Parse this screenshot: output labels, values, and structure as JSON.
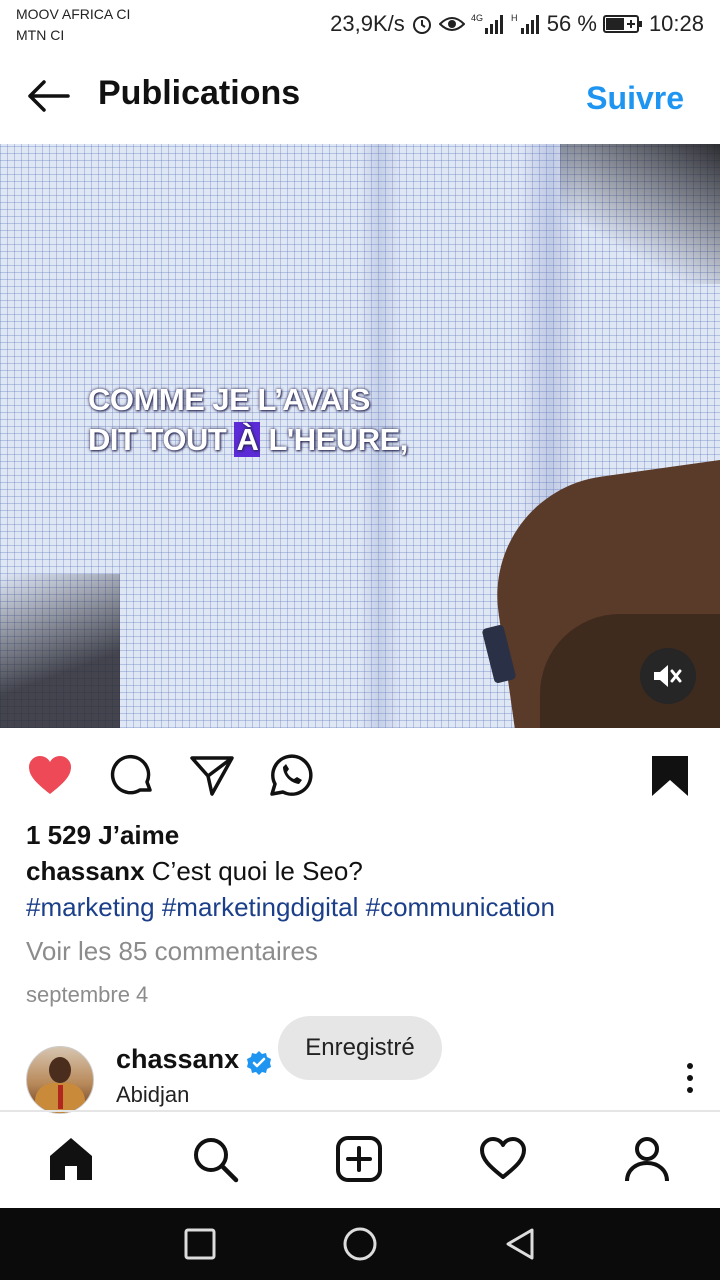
{
  "status_bar": {
    "carrier_1": "MOOV AFRICA CI",
    "carrier_2": "MTN CI",
    "speed": "23,9K/s",
    "battery": "56 %",
    "time": "10:28",
    "icons": [
      "alarm-icon",
      "eye-icon",
      "signal-4g-icon",
      "signal-h-icon",
      "battery-icon"
    ]
  },
  "header": {
    "title": "Publications",
    "follow_label": "Suivre"
  },
  "media": {
    "overlay_line1": "COMME JE L’AVAIS",
    "overlay_line2_a": "DIT TOUT ",
    "overlay_line2_hl": "À",
    "overlay_line2_b": " L'HEURE,"
  },
  "post": {
    "likes": "1 529 J’aime",
    "author": "chassanx",
    "caption": "C’est quoi le Seo?",
    "hashtags": "#marketing #marketingdigital #communication",
    "comments_link": "Voir les 85 commentaires",
    "date": "septembre 4",
    "liked": true,
    "saved": true
  },
  "author_row": {
    "username": "chassanx",
    "location": "Abidjan",
    "toast": "Enregistré"
  },
  "colors": {
    "accent": "#1e95f0",
    "like": "#ed4956",
    "hashtag": "#1c3f8a",
    "muted_text": "#8c8c8c"
  }
}
